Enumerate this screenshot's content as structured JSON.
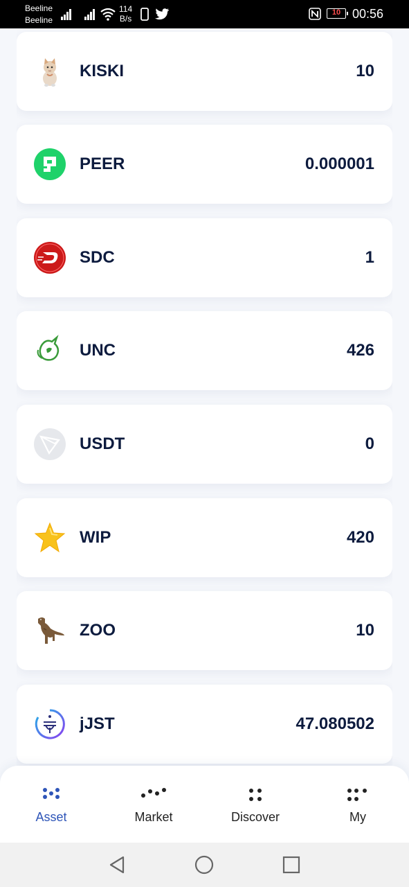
{
  "status_bar": {
    "carrier1": "Beeline",
    "carrier2": "Beeline",
    "speed_value": "114",
    "speed_unit": "B/s",
    "battery": "10",
    "time": "00:56"
  },
  "tokens": [
    {
      "symbol": "KISKI",
      "balance": "10",
      "icon": "kitten-icon"
    },
    {
      "symbol": "PEER",
      "balance": "0.000001",
      "icon": "peer-logo-icon"
    },
    {
      "symbol": "SDC",
      "balance": "1",
      "icon": "sdc-logo-icon"
    },
    {
      "symbol": "UNC",
      "balance": "426",
      "icon": "unicorn-icon"
    },
    {
      "symbol": "USDT",
      "balance": "0",
      "icon": "tron-logo-icon"
    },
    {
      "symbol": "WIP",
      "balance": "420",
      "icon": "star-icon"
    },
    {
      "symbol": "ZOO",
      "balance": "10",
      "icon": "dinosaur-icon"
    },
    {
      "symbol": "jJST",
      "balance": "47.080502",
      "icon": "jst-logo-icon"
    }
  ],
  "bottom_nav": {
    "asset": "Asset",
    "market": "Market",
    "discover": "Discover",
    "my": "My",
    "active": "Asset",
    "accent_color": "#2e55b8"
  },
  "colors": {
    "peer": "#1fd26a",
    "sdc": "#d41f1f",
    "unc": "#3a9b3a",
    "star": "#f8c21c"
  }
}
